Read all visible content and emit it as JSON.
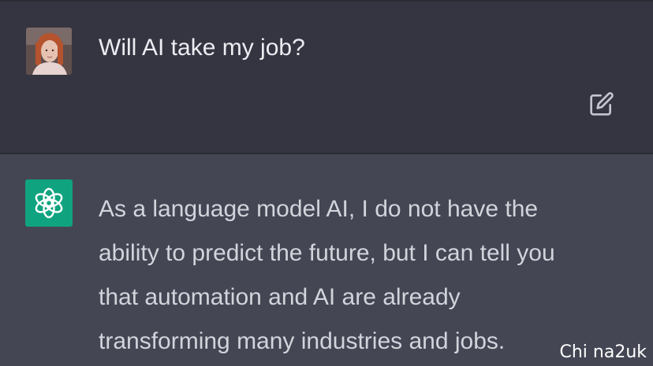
{
  "conversation": {
    "user_message": {
      "avatar": "user-photo-avatar",
      "text": "Will AI take my job?",
      "edit_icon": "edit-icon"
    },
    "assistant_message": {
      "avatar": "openai-logo-icon",
      "avatar_color": "#10a37f",
      "lines": [
        "As a language model AI, I do not have the",
        "ability to predict the future, but I can tell you",
        "that automation and AI are already",
        "transforming many industries and jobs."
      ]
    }
  },
  "watermark": {
    "text": "Chi na2uk"
  },
  "colors": {
    "user_row_bg": "#343541",
    "assistant_row_bg": "#444654",
    "user_text": "#ececf1",
    "assistant_text": "#d1d5db"
  }
}
